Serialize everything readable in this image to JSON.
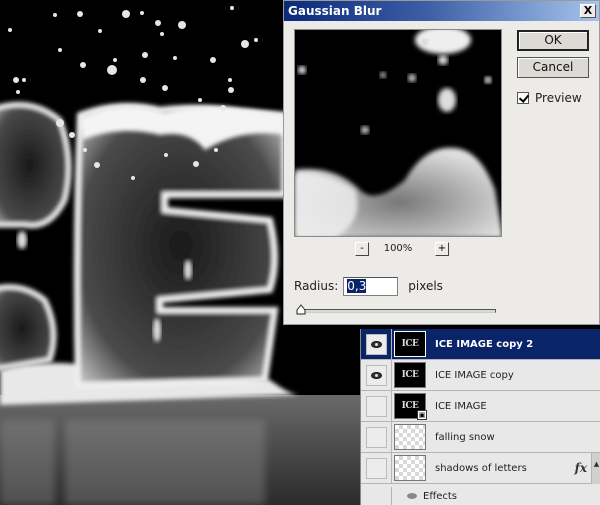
{
  "dialog": {
    "title": "Gaussian Blur",
    "close_label": "X",
    "ok_label": "OK",
    "cancel_label": "Cancel",
    "preview_label": "Preview",
    "preview_checked": true,
    "zoom_out_label": "-",
    "zoom_in_label": "+",
    "zoom_level": "100%",
    "radius_label": "Radius:",
    "radius_value": "0,3",
    "radius_units": "pixels",
    "radius_slider_fraction": 0.0
  },
  "layers": {
    "items": [
      {
        "name": "ICE IMAGE copy 2",
        "visible": true,
        "selected": true,
        "thumb": "ICE",
        "type": "image"
      },
      {
        "name": "ICE IMAGE copy",
        "visible": true,
        "selected": false,
        "thumb": "ICE",
        "type": "image"
      },
      {
        "name": "ICE IMAGE",
        "visible": false,
        "selected": false,
        "thumb": "ICE",
        "type": "smart-object"
      },
      {
        "name": "falling snow",
        "visible": false,
        "selected": false,
        "thumb": "",
        "type": "transparent"
      },
      {
        "name": "shadows of letters",
        "visible": false,
        "selected": false,
        "thumb": "",
        "type": "transparent",
        "fx": "fx"
      }
    ],
    "effects_label": "Effects"
  },
  "colors": {
    "selected_layer": "#0a246a",
    "dialog_bg": "#ecebe8",
    "title_gradient_start": "#0a2a7a",
    "title_gradient_end": "#a6c4ec"
  }
}
